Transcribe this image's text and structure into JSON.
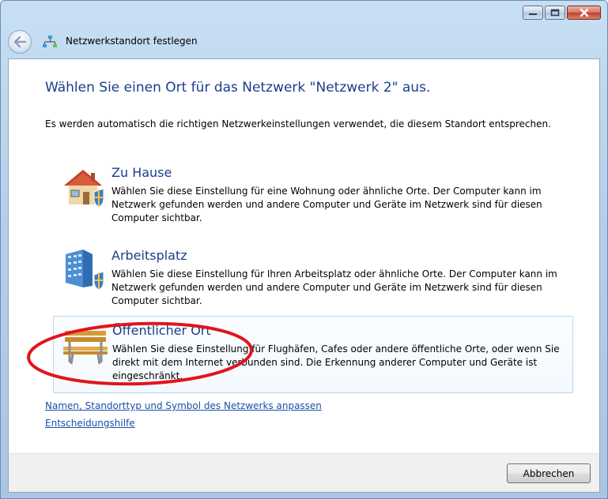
{
  "window": {
    "title": "Netzwerkstandort festlegen"
  },
  "content": {
    "heading": "Wählen Sie einen Ort für das Netzwerk \"Netzwerk  2\" aus.",
    "intro": "Es werden automatisch die richtigen Netzwerkeinstellungen verwendet, die diesem Standort entsprechen.",
    "options": [
      {
        "title": "Zu Hause",
        "description": "Wählen Sie diese Einstellung für eine Wohnung oder ähnliche Orte. Der Computer kann im Netzwerk gefunden werden und andere Computer und Geräte im Netzwerk sind für diesen Computer sichtbar.",
        "icon": "house-icon"
      },
      {
        "title": "Arbeitsplatz",
        "description": "Wählen Sie diese Einstellung für Ihren Arbeitsplatz oder ähnliche Orte. Der Computer kann im Netzwerk gefunden werden und andere Computer und Geräte im Netzwerk sind für diesen Computer sichtbar.",
        "icon": "office-building-icon"
      },
      {
        "title": "Öffentlicher Ort",
        "description": "Wählen Sie diese Einstellung für Flughäfen, Cafes oder andere öffentliche Orte, oder wenn Sie direkt mit dem Internet verbunden sind. Die Erkennung anderer Computer und Geräte ist eingeschränkt.",
        "icon": "park-bench-icon"
      }
    ],
    "links": {
      "customize": "Namen, Standorttyp und Symbol des Netzwerks anpassen",
      "help": "Entscheidungshilfe"
    }
  },
  "footer": {
    "cancel_label": "Abbrechen"
  },
  "colors": {
    "heading": "#1a3e8c",
    "link": "#1a4fa8",
    "annotation": "#e2141c",
    "selection_border": "#b6d7ee"
  }
}
